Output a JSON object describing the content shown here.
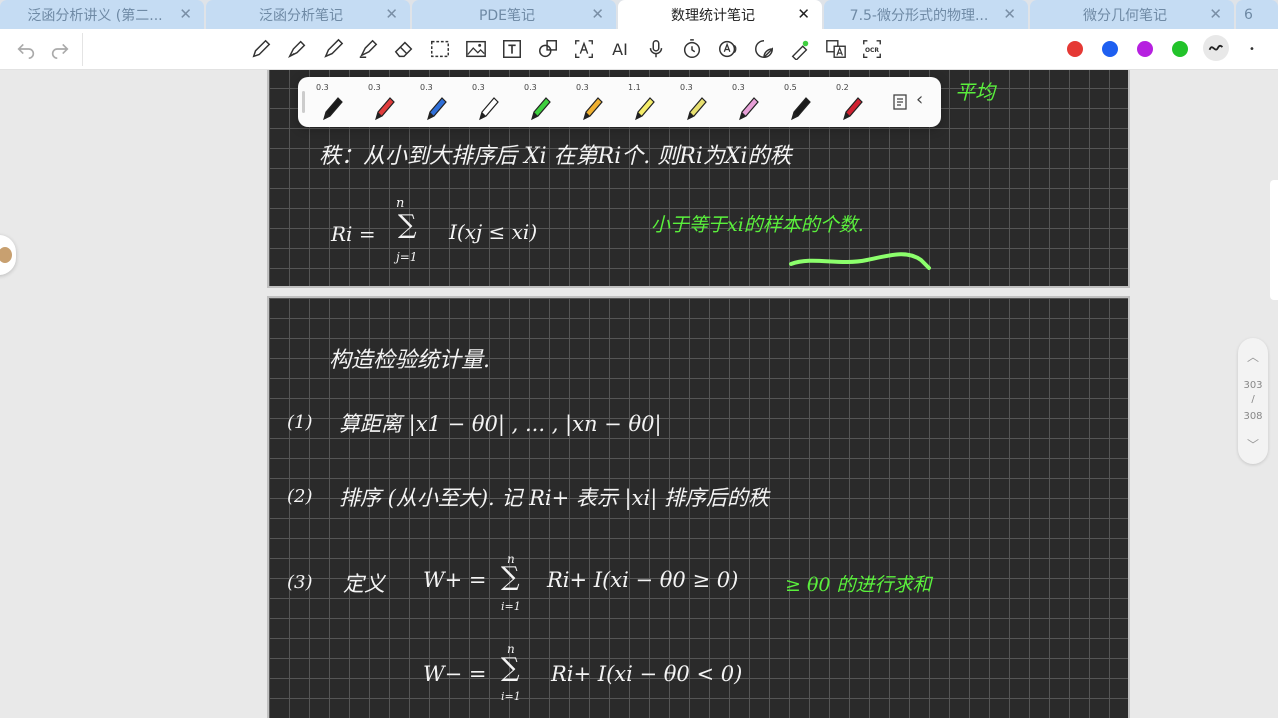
{
  "tabs": [
    {
      "label": "泛函分析讲义 (第二...",
      "active": false
    },
    {
      "label": "泛函分析笔记",
      "active": false
    },
    {
      "label": "PDE笔记",
      "active": false
    },
    {
      "label": "数理统计笔记",
      "active": true
    },
    {
      "label": "7.5-微分形式的物理...",
      "active": false
    },
    {
      "label": "微分几何笔记",
      "active": false
    }
  ],
  "tab_count": "6",
  "tab_close": "✕",
  "toolbar": {
    "undo_icon": "undo-icon",
    "redo_icon": "redo-icon",
    "text_tool": "T",
    "ai_tool": "AI",
    "ocr_tool": "OCR",
    "colors": [
      "#e53935",
      "#1e5ff0",
      "#b620e0",
      "#22c32a"
    ],
    "more": "•"
  },
  "pen_panel": {
    "pens": [
      {
        "size": "0.3",
        "color": "#1a1a1a"
      },
      {
        "size": "0.3",
        "color": "#e03c3c"
      },
      {
        "size": "0.3",
        "color": "#2f6fd8"
      },
      {
        "size": "0.3",
        "color": "#ffffff"
      },
      {
        "size": "0.3",
        "color": "#3fcf3f"
      },
      {
        "size": "0.3",
        "color": "#f0b030"
      },
      {
        "size": "1.1",
        "color": "#f4ec6a"
      },
      {
        "size": "0.3",
        "color": "#e8e070"
      },
      {
        "size": "0.3",
        "color": "#e8a0d8"
      },
      {
        "size": "0.5",
        "color": "#1a1a1a"
      },
      {
        "size": "0.2",
        "color": "#d02030"
      }
    ],
    "collapse": "‹"
  },
  "page1": {
    "partial_top_green": "平均",
    "rank_def": "秩：从小到大排序后 Xi 在第Ri个.    则Ri为Xi的秩",
    "formula_lhs": "Ri =",
    "sum_top": "n",
    "sum_sym": "∑",
    "sum_bottom": "j=1",
    "indicator": "I(xj ≤ xi)",
    "annotation": "小于等于xi的样本的个数."
  },
  "page2": {
    "heading": "构造检验统计量.",
    "step1_num": "(1)",
    "step1_text": "算距离  |x1 − θ0| ,  ... ,  |xn − θ0|",
    "step2_num": "(2)",
    "step2_text": "排序 (从小至大). 记 Ri+ 表示 |xi| 排序后的秩",
    "step3_num": "(3)",
    "step3_text": "定义",
    "w_plus_lhs": "W+ =",
    "w_plus_sum_top": "n",
    "w_plus_sum_bottom": "i=1",
    "w_plus_rhs": "Ri+  I(xi − θ0 ≥ 0)",
    "w_plus_note": "≥ θ0 的进行求和",
    "w_minus_lhs": "W− =",
    "w_minus_sum_top": "n",
    "w_minus_sum_bottom": "i=1",
    "w_minus_rhs": "Ri+  I(xi − θ0 < 0)"
  },
  "page_nav": {
    "current": "303",
    "slash": "/",
    "total": "308"
  }
}
